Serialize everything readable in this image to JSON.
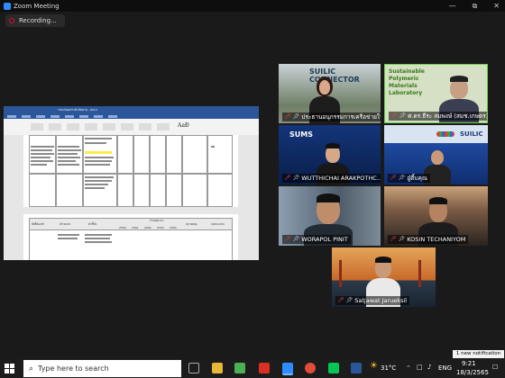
{
  "window": {
    "title": "Zoom Meeting",
    "controls": [
      "—",
      "⧉",
      "✕"
    ]
  },
  "recording": {
    "label": "Recording..."
  },
  "shared_doc": {
    "title": "รายงานผลการดำเนินงาน - Word",
    "font_label": "AaÐ",
    "table2_headers": [
      "สิ่งที่ต้องทำ",
      "เป้าหมาย",
      "ตัวชี้วัด",
      "กำหนดเวลา",
      "หมายเหตุ",
      "งบประมาณ"
    ],
    "years": [
      "2560",
      "2561",
      "2562",
      "2563",
      "2564"
    ]
  },
  "participants": [
    {
      "name": "ประธานอนุกรรมการเครือข่ายให้...",
      "bg": "SUILIC CONNECTOR"
    },
    {
      "name": "ศ.ดร.ธีระ สมพงษ์ (สมช.เกษตร) สำนัก",
      "bg": "Sustainable Polymeric Materials Laboratory"
    },
    {
      "name": "WUTTHICHAI ARAKPOTHC...",
      "bg": "SUMS"
    },
    {
      "name": "อู๋ตี้บคุณ",
      "bg": "SUILIC"
    },
    {
      "name": "WORAPOL PINIT",
      "bg": ""
    },
    {
      "name": "KOSIN TECHANIYOM",
      "bg": ""
    },
    {
      "name": "Satjawat Jarueksil",
      "bg": ""
    }
  ],
  "taskbar": {
    "search_placeholder": "Type here to search",
    "temperature": "31°C",
    "time": "9:21",
    "date": "18/3/2565",
    "notification": "1 new notification",
    "lang": "ENG"
  },
  "colors": {
    "accent": "#2d8cff",
    "active_speaker": "#6bd34b",
    "word_blue": "#2b579a",
    "muted": "#ff3b3b"
  }
}
